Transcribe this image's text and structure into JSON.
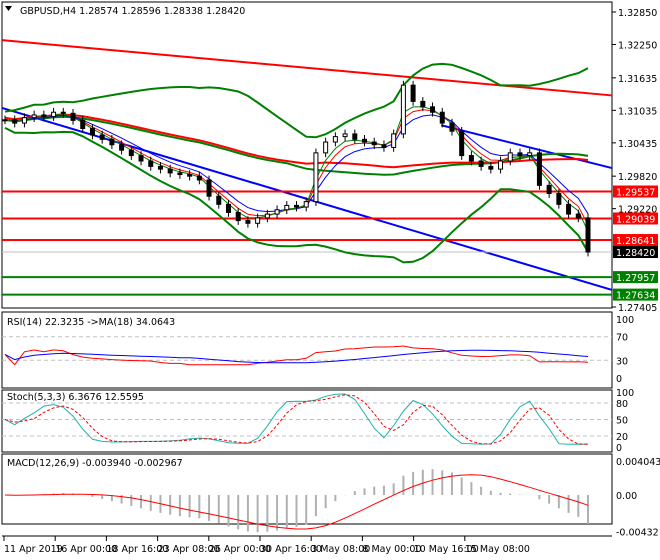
{
  "chart_data": {
    "type": "line",
    "title": "GBPUSD,H4",
    "ohlc_header": "1.28574 1.28596 1.28338 1.28420",
    "price_axis_ticks": [
      "1.32850",
      "1.32250",
      "1.31635",
      "1.31035",
      "1.30435",
      "1.29820",
      "1.29220",
      "1.27405"
    ],
    "price_ylim": [
      1.27405,
      1.3285
    ],
    "closes": [
      1.3086,
      1.308,
      1.309,
      1.3095,
      1.3092,
      1.31,
      1.3098,
      1.3085,
      1.307,
      1.3058,
      1.305,
      1.304,
      1.303,
      1.302,
      1.301,
      1.3,
      1.2995,
      1.2988,
      1.2985,
      1.2982,
      1.2975,
      1.2945,
      1.293,
      1.2915,
      1.29,
      1.2895,
      1.2905,
      1.2912,
      1.292,
      1.2928,
      1.2925,
      1.2935,
      1.3025,
      1.3045,
      1.3055,
      1.306,
      1.305,
      1.3045,
      1.304,
      1.3035,
      1.306,
      1.315,
      1.312,
      1.311,
      1.31,
      1.308,
      1.3065,
      1.302,
      1.301,
      1.3,
      1.2995,
      1.301,
      1.3025,
      1.302,
      1.3025,
      1.2965,
      1.295,
      1.293,
      1.2912,
      1.2905,
      1.2842
    ],
    "levels": [
      {
        "value": 1.29537,
        "label": "1.29537",
        "color": "#ff0000"
      },
      {
        "value": 1.29039,
        "label": "1.29039",
        "color": "#ff0000"
      },
      {
        "value": 1.28641,
        "label": "1.28641",
        "color": "#ff0000"
      },
      {
        "value": 1.2842,
        "label": "1.28420",
        "color": "#000000",
        "line": "#c0c0c0"
      },
      {
        "value": 1.27957,
        "label": "1.27957",
        "color": "#008000"
      },
      {
        "value": 1.27634,
        "label": "1.27634",
        "color": "#008000"
      }
    ],
    "trendlines": [
      {
        "from": [
          0,
          1.3233
        ],
        "to": [
          1,
          1.3131
        ],
        "color": "#ff0000"
      },
      {
        "from": [
          0,
          1.3108
        ],
        "to": [
          1,
          1.2772
        ],
        "color": "#0000ff"
      },
      {
        "from": [
          0.72,
          1.3076
        ],
        "to": [
          1,
          1.2997
        ],
        "color": "#0000ff"
      }
    ],
    "x_labels": [
      "11 Apr 2019",
      "16 Apr 00:00",
      "18 Apr 16:00",
      "23 Apr 08:00",
      "26 Apr 00:00",
      "30 Apr 16:00",
      "3 May 08:00",
      "8 May 00:00",
      "10 May 16:00",
      "15 May 08:00"
    ],
    "rsi": {
      "header": "RSI(14) 22.3235  ->MA(18) 34.0643",
      "ticks": [
        "100",
        "70",
        "30",
        "0"
      ]
    },
    "stoch": {
      "header": "Stoch(5,3,3) 6.3676 12.5595",
      "ticks": [
        "100",
        "80",
        "50",
        "20",
        "0"
      ]
    },
    "macd": {
      "header": "MACD(12,26,9) -0.003940 -0.002967",
      "ticks": [
        "0.004043",
        "0.00",
        "-0.00432"
      ]
    },
    "colors": {
      "up": "#000000",
      "bull_band": "#008000",
      "ma_red": "#ff0000",
      "ma_blue": "#0000ff",
      "stoch_main": "#20b2aa",
      "grid": "#c0c0c0"
    }
  }
}
